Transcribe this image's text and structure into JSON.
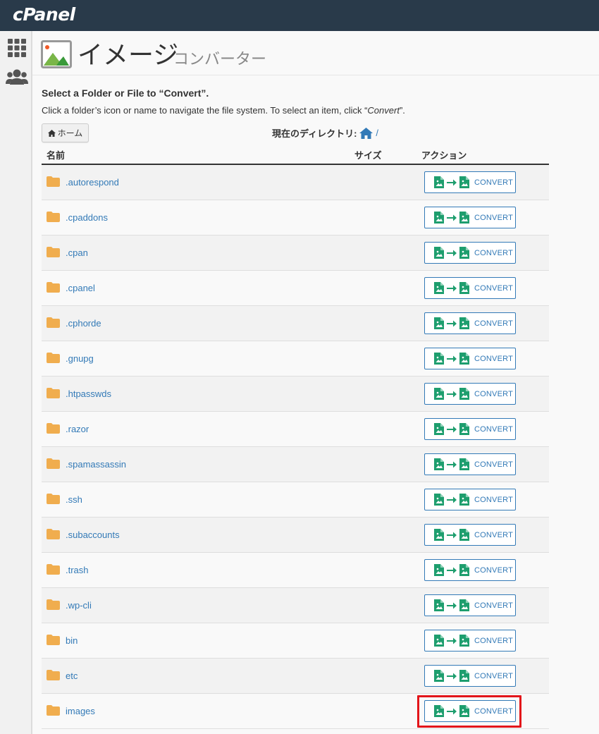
{
  "topbar": {
    "logo": "cPanel"
  },
  "header": {
    "title": "イメージ",
    "subtitle": "コンバーター"
  },
  "instructions": {
    "title": "Select a Folder or File to “Convert”.",
    "text_prefix": "Click a folder’s icon or name to navigate the file system. To select an item, click “",
    "text_emph": "Convert",
    "text_suffix": "”."
  },
  "nav": {
    "home_label": "ホーム",
    "current_dir_label": "現在のディレクトリ:",
    "current_dir_path": "/"
  },
  "table": {
    "col_name": "名前",
    "col_size": "サイズ",
    "col_action": "アクション",
    "convert_label": "CONVERT",
    "rows": [
      ".autorespond",
      ".cpaddons",
      ".cpan",
      ".cpanel",
      ".cphorde",
      ".gnupg",
      ".htpasswds",
      ".razor",
      ".spamassassin",
      ".ssh",
      ".subaccounts",
      ".trash",
      ".wp-cli",
      "bin",
      "etc",
      "images"
    ]
  },
  "colors": {
    "topbar": "#293a4a",
    "link": "#337ab7",
    "folder": "#f0ad4e",
    "convert_icon": "#1e9e6e",
    "highlight": "#e3151a"
  },
  "icons": {
    "sidebar": [
      "grid-icon",
      "users-icon"
    ],
    "page": "image-icon",
    "home": "home-icon",
    "folder": "folder-icon",
    "convert": [
      "image-file-icon",
      "arrow-right-icon",
      "image-file-icon"
    ]
  }
}
